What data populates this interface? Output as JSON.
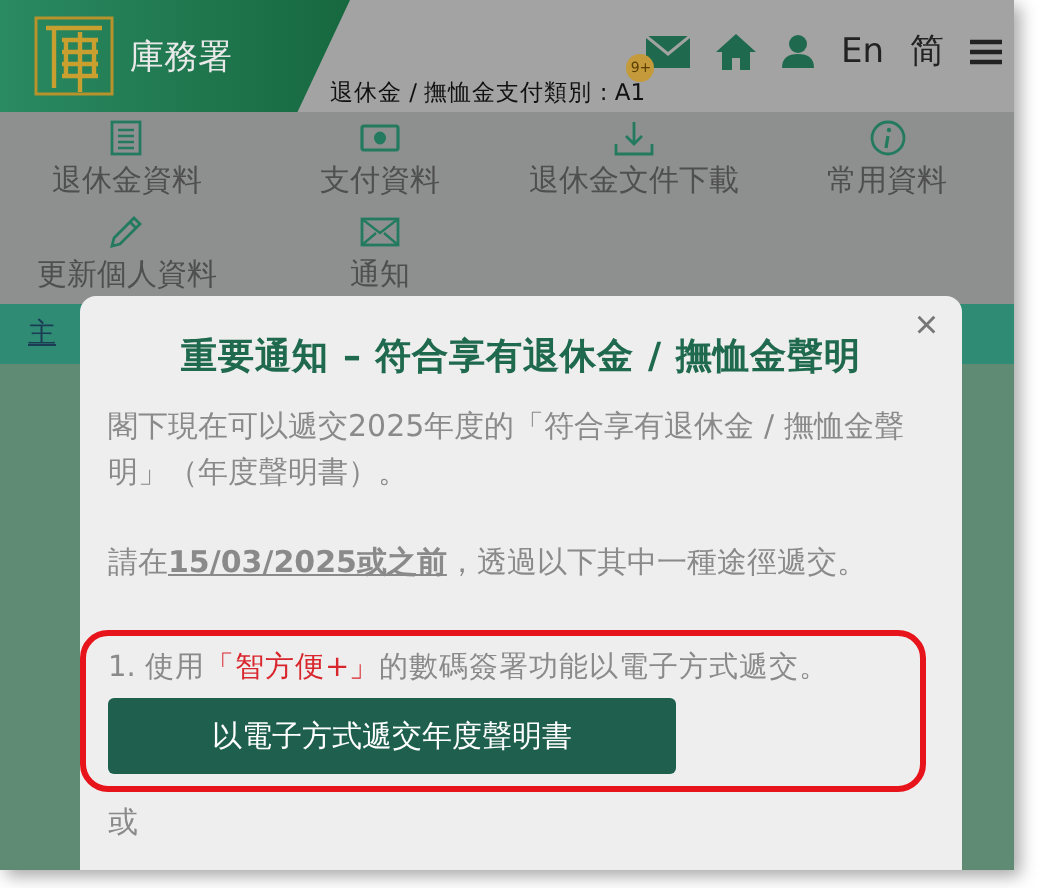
{
  "header": {
    "agency": "庫務署",
    "notice_badge": "9+",
    "language_links": [
      "En",
      "简"
    ],
    "pension_type": "退休金 / 撫恤金支付類別 : A1"
  },
  "nav": [
    {
      "label": "退休金資料",
      "kind": "document"
    },
    {
      "label": "支付資料",
      "kind": "cash"
    },
    {
      "label": "退休金文件下載",
      "kind": "download"
    },
    {
      "label": "常用資料",
      "kind": "info"
    },
    {
      "label": "更新個人資料",
      "kind": "pencil"
    },
    {
      "label": "通知",
      "kind": "mail"
    }
  ],
  "breadcrumb": "主",
  "modal": {
    "title": "重要通知 – 符合享有退休金 / 撫恤金聲明",
    "close": "×",
    "paragraphs": [
      "閣下現在可以遞交2025年度的「符合享有退休金 / 撫恤金聲明」（年度聲明書）。",
      "請在**15/03/2025或之前**，透過以下其中一種途徑遞交。"
    ],
    "option": "1. 使用**「智方便+」**的數碼簽署功能以電子方式遞交。",
    "submit_button": "以電子方式遞交年度聲明書",
    "separator": "或"
  }
}
